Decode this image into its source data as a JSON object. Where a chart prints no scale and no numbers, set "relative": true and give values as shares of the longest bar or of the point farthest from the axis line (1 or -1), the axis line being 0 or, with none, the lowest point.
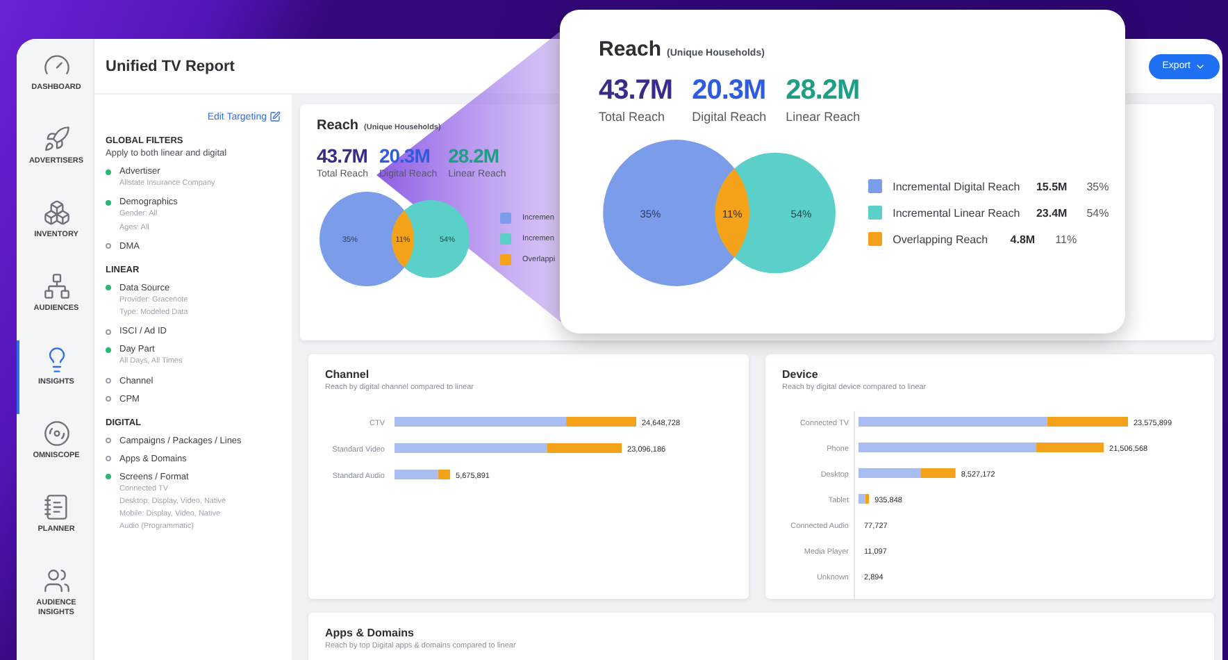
{
  "sidebar": {
    "items": [
      {
        "label": "DASHBOARD",
        "selected": false
      },
      {
        "label": "ADVERTISERS",
        "selected": false
      },
      {
        "label": "INVENTORY",
        "selected": false
      },
      {
        "label": "AUDIENCES",
        "selected": false
      },
      {
        "label": "INSIGHTS",
        "selected": true
      },
      {
        "label": "OMNISCOPE",
        "selected": false
      },
      {
        "label": "PLANNER",
        "selected": false
      },
      {
        "label": "AUDIENCE INSIGHTS",
        "selected": false
      }
    ]
  },
  "header": {
    "title": "Unified TV Report",
    "export_button": "Export"
  },
  "filters": {
    "edit_link": "Edit Targeting",
    "sections": [
      {
        "title": "GLOBAL FILTERS",
        "subtitle": "Apply to both linear and digital",
        "items": [
          {
            "label": "Advertiser",
            "active": true,
            "details": [
              "Allstate Insurance Company"
            ]
          },
          {
            "label": "Demographics",
            "active": true,
            "details": [
              "Gender: All",
              "Ages: All"
            ]
          },
          {
            "label": "DMA",
            "active": false
          }
        ]
      },
      {
        "title": "LINEAR",
        "items": [
          {
            "label": "Data Source",
            "active": true,
            "details": [
              "Provider: Gracenote",
              "Type: Modeled Data"
            ]
          },
          {
            "label": "ISCI / Ad ID",
            "active": false
          },
          {
            "label": "Day Part",
            "active": true,
            "details": [
              "All Days, All Times"
            ]
          },
          {
            "label": "Channel",
            "active": false
          },
          {
            "label": "CPM",
            "active": false
          }
        ]
      },
      {
        "title": "DIGITAL",
        "items": [
          {
            "label": "Campaigns / Packages / Lines",
            "active": false
          },
          {
            "label": "Apps & Domains",
            "active": false
          },
          {
            "label": "Screens / Format",
            "active": true,
            "details": [
              "Connected TV",
              "Desktop: Display, Video, Native",
              "Mobile: Display, Video, Native",
              "Audio (Programmatic)"
            ]
          }
        ]
      }
    ]
  },
  "reach_card": {
    "title": "Reach",
    "subtitle": "(Unique Households)",
    "stats": [
      {
        "value": "43.7M",
        "label": "Total Reach",
        "color": "#3b2a8c"
      },
      {
        "value": "20.3M",
        "label": "Digital Reach",
        "color": "#2f5be0"
      },
      {
        "value": "28.2M",
        "label": "Linear Reach",
        "color": "#1f9e86"
      }
    ],
    "venn_labels": [
      "35%",
      "11%",
      "54%"
    ],
    "legend": [
      {
        "label": "Incremen",
        "color": "#7b9ce8"
      },
      {
        "label": "Incremen",
        "color": "#5ad0c8"
      },
      {
        "label": "Overlappi",
        "color": "#f5a21b"
      }
    ]
  },
  "callout": {
    "title": "Reach",
    "subtitle": "(Unique Households)",
    "stats": [
      {
        "value": "43.7M",
        "label": "Total Reach",
        "color": "#3b2a8c"
      },
      {
        "value": "20.3M",
        "label": "Digital Reach",
        "color": "#2f5be0"
      },
      {
        "value": "28.2M",
        "label": "Linear Reach",
        "color": "#1f9e86"
      }
    ],
    "venn_labels": [
      "35%",
      "11%",
      "54%"
    ],
    "legend": [
      {
        "label": "Incremental Digital Reach",
        "value": "15.5M",
        "percent": "35%",
        "color": "#7b9ce8"
      },
      {
        "label": "Incremental Linear Reach",
        "value": "23.4M",
        "percent": "54%",
        "color": "#5ad0c8"
      },
      {
        "label": "Overlapping Reach",
        "value": "4.8M",
        "percent": "11%",
        "color": "#f5a21b"
      }
    ]
  },
  "channel_card": {
    "title": "Channel",
    "subtitle": "Reach by digital channel compared to linear",
    "chart_data": {
      "type": "bar",
      "orientation": "horizontal",
      "stacked": true,
      "relative": true,
      "categories": [
        "CTV",
        "Standard Video",
        "Standard Audio"
      ],
      "series": [
        {
          "color": "#a9bdf0",
          "values": [
            0.71,
            0.63,
            0.18
          ]
        },
        {
          "color": "#f5a21b",
          "values": [
            0.29,
            0.31,
            0.05
          ]
        }
      ],
      "value_labels": [
        "24,648,728",
        "23,096,186",
        "5,675,891"
      ]
    }
  },
  "device_card": {
    "title": "Device",
    "subtitle": "Reach by digital device compared to linear",
    "chart_data": {
      "type": "bar",
      "orientation": "horizontal",
      "stacked": true,
      "relative": true,
      "categories": [
        "Connected TV",
        "Phone",
        "Desktop",
        "Tablet",
        "Connected Audio",
        "Media Player",
        "Unknown"
      ],
      "series": [
        {
          "color": "#a9bdf0",
          "values": [
            0.7,
            0.66,
            0.23,
            0.025,
            null,
            null,
            null
          ]
        },
        {
          "color": "#f5a21b",
          "values": [
            0.3,
            0.25,
            0.13,
            0.014,
            null,
            null,
            null
          ]
        }
      ],
      "value_labels": [
        "23,575,899",
        "21,506,568",
        "8,527,172",
        "935,848",
        "77,727",
        "11,097",
        "2,894"
      ]
    }
  },
  "apps_card": {
    "title": "Apps & Domains",
    "subtitle": "Reach by top Digital apps & domains compared to linear"
  }
}
